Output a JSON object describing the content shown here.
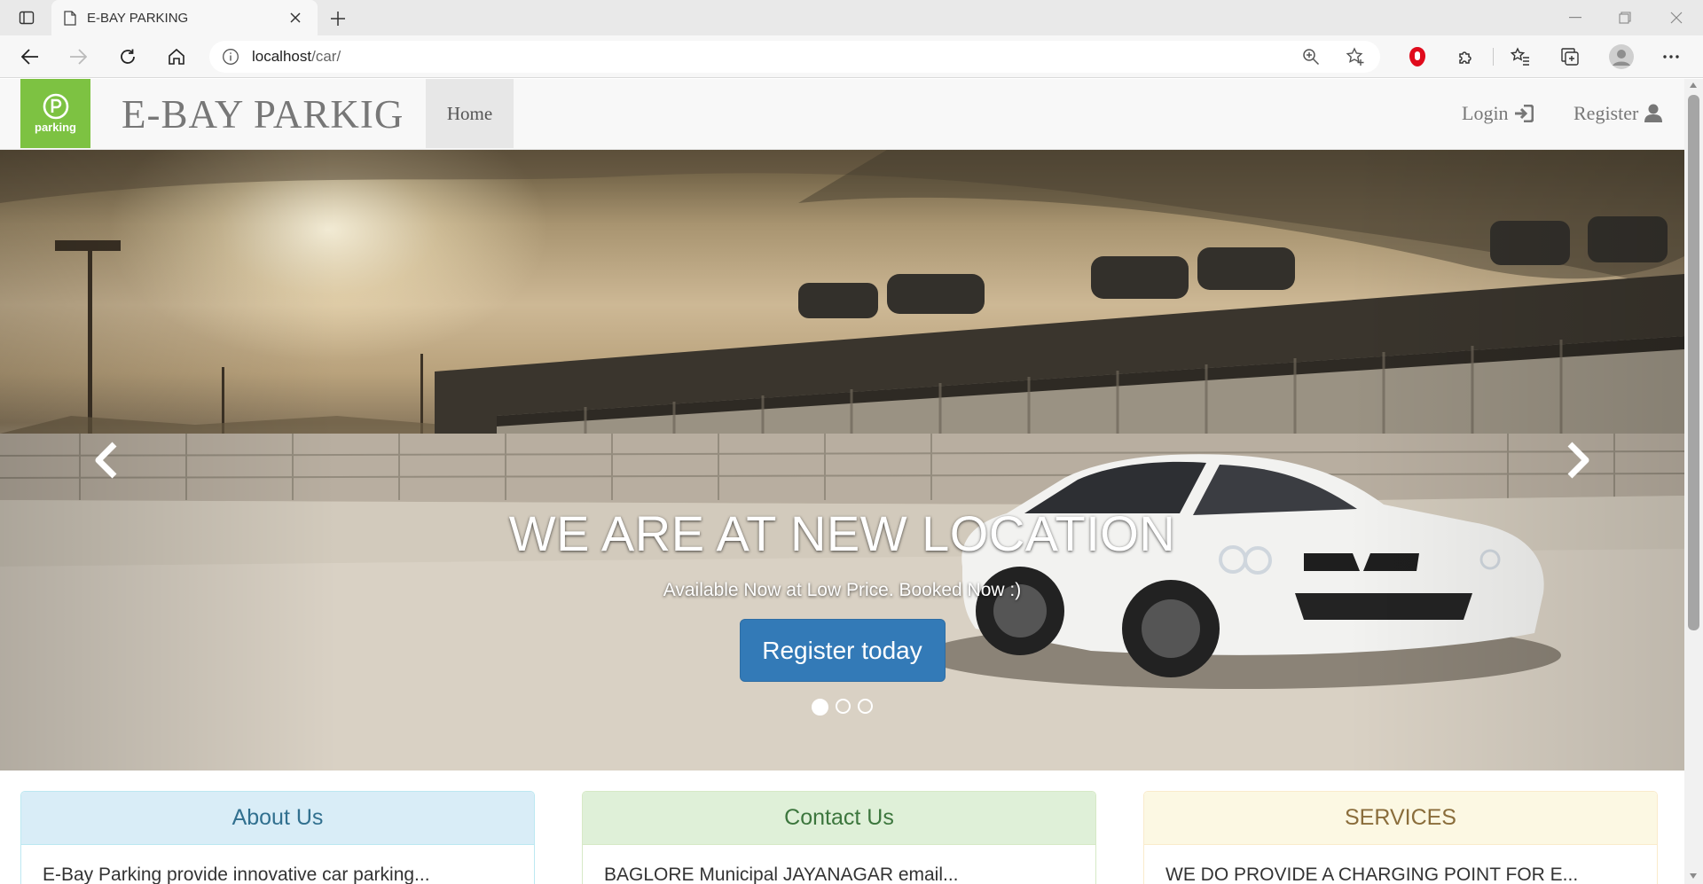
{
  "browser": {
    "tab_title": "E-BAY PARKING",
    "url_host": "localhost",
    "url_path": "/car/"
  },
  "navbar": {
    "logo_text": "parking",
    "brand": "E-BAY PARKIG",
    "home": "Home",
    "login": "Login",
    "register": "Register"
  },
  "carousel": {
    "title": "WE ARE AT NEW LOCATION",
    "subtitle": "Available Now at Low Price. Booked Now :)",
    "button": "Register today",
    "active_slide": 1,
    "slide_count": 3
  },
  "panels": [
    {
      "title": "About Us",
      "body": "E-Bay Parking provide innovative car parking...",
      "color": "#31708f",
      "bg": "#d9edf7",
      "border": "#bce8f1"
    },
    {
      "title": "Contact Us",
      "body": "BAGLORE Municipal JAYANAGAR email...",
      "color": "#3c763d",
      "bg": "#dff0d8",
      "border": "#d6e9c6"
    },
    {
      "title": "SERVICES",
      "body": "WE DO PROVIDE A CHARGING POINT FOR E...",
      "color": "#8a6d3b",
      "bg": "#fcf8e3",
      "border": "#faebcc"
    }
  ],
  "colors": {
    "primary": "#337ab7",
    "logo_green": "#7dc242"
  }
}
